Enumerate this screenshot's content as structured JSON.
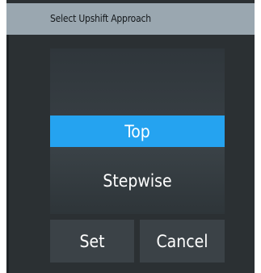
{
  "dialog": {
    "title": "Select Upshift Approach",
    "options": [
      {
        "label": "",
        "selected": false
      },
      {
        "label": "Top",
        "selected": true
      },
      {
        "label": "Stepwise",
        "selected": false
      }
    ],
    "buttons": {
      "set_label": "Set",
      "cancel_label": "Cancel"
    },
    "colors": {
      "titlebar": "#9aa7b0",
      "background": "#2b3033",
      "selection": "#25a3f0",
      "button": "#3b4247"
    }
  }
}
